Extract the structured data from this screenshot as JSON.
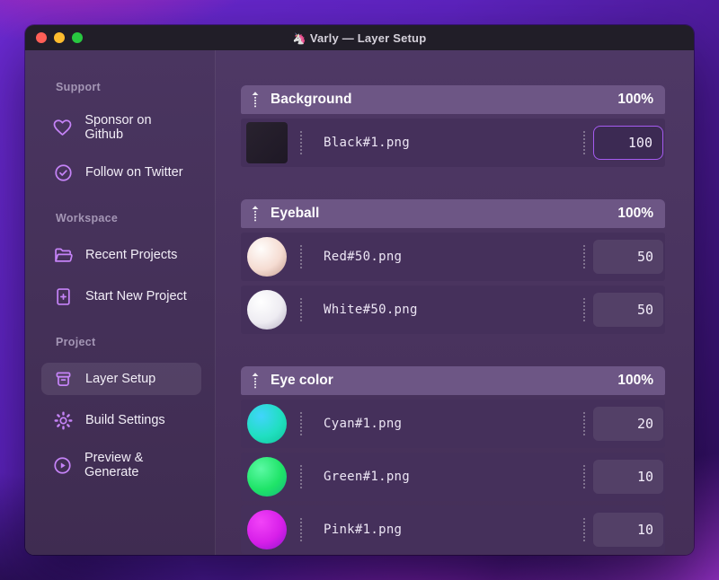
{
  "window": {
    "title": "Varly — Layer Setup",
    "app_icon": "unicorn-icon",
    "app_icon_glyph": "🦄",
    "traffic_lights": [
      {
        "name": "close",
        "color": "#ff5f57"
      },
      {
        "name": "minimize",
        "color": "#febc2e"
      },
      {
        "name": "zoom",
        "color": "#28c840"
      }
    ]
  },
  "colors": {
    "accent": "#a55bf0",
    "sidebar_icon": "#c583f7",
    "group_header_bg": "#6d5685",
    "row_bg": "#45305b"
  },
  "sidebar": {
    "sections": [
      {
        "label": "Support",
        "items": [
          {
            "icon": "heart-icon",
            "label": "Sponsor on Github",
            "selected": false
          },
          {
            "icon": "check-badge-icon",
            "label": "Follow on Twitter",
            "selected": false
          }
        ]
      },
      {
        "label": "Workspace",
        "items": [
          {
            "icon": "folder-icon",
            "label": "Recent Projects",
            "selected": false
          },
          {
            "icon": "file-plus-icon",
            "label": "Start New Project",
            "selected": false
          }
        ]
      },
      {
        "label": "Project",
        "items": [
          {
            "icon": "archive-box-icon",
            "label": "Layer Setup",
            "selected": true
          },
          {
            "icon": "gear-icon",
            "label": "Build Settings",
            "selected": false
          },
          {
            "icon": "play-circle-icon",
            "label": "Preview & Generate",
            "selected": false
          }
        ]
      }
    ]
  },
  "layers": {
    "groups": [
      {
        "name": "Background",
        "weight": "100%",
        "items": [
          {
            "file": "Black#1.png",
            "value": "100",
            "focused": true,
            "thumb": {
              "shape": "square",
              "colors": [
                "#29222f",
                "#1e1825"
              ]
            }
          }
        ]
      },
      {
        "name": "Eyeball",
        "weight": "100%",
        "items": [
          {
            "file": "Red#50.png",
            "value": "50",
            "focused": false,
            "thumb": {
              "shape": "circle",
              "colors": [
                "#fffdfb",
                "#f5dcd2",
                "#c39a8e"
              ]
            }
          },
          {
            "file": "White#50.png",
            "value": "50",
            "focused": false,
            "thumb": {
              "shape": "circle",
              "colors": [
                "#ffffff",
                "#eeecf2",
                "#b5afc2"
              ]
            }
          }
        ]
      },
      {
        "name": "Eye color",
        "weight": "100%",
        "items": [
          {
            "file": "Cyan#1.png",
            "value": "20",
            "focused": false,
            "thumb": {
              "shape": "circle",
              "colors": [
                "#41d4fc",
                "#20dfc0",
                "#0fc497"
              ]
            }
          },
          {
            "file": "Green#1.png",
            "value": "10",
            "focused": false,
            "thumb": {
              "shape": "circle",
              "colors": [
                "#5bf9a4",
                "#1fe468",
                "#12b87e"
              ]
            }
          },
          {
            "file": "Pink#1.png",
            "value": "10",
            "focused": false,
            "thumb": {
              "shape": "circle",
              "colors": [
                "#f243f8",
                "#d71fe9",
                "#9014cd"
              ]
            }
          }
        ]
      }
    ]
  }
}
